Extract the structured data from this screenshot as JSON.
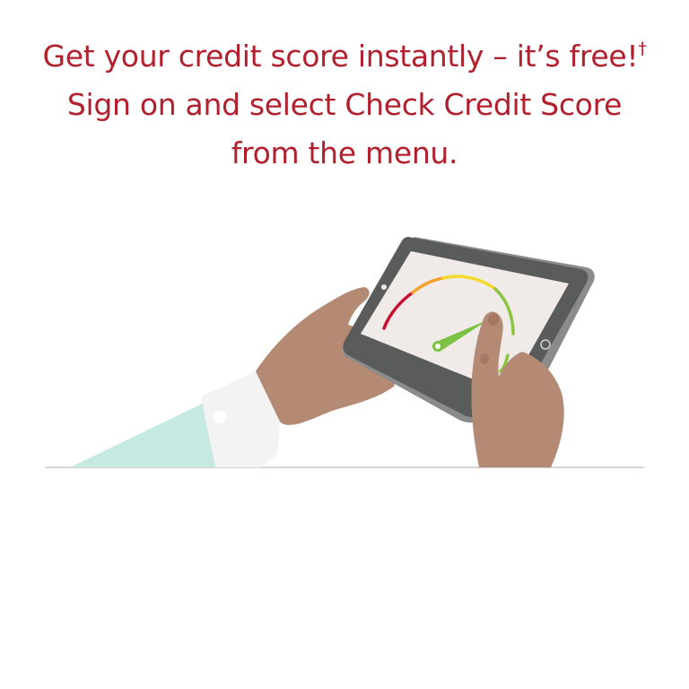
{
  "headline": {
    "part1": "Get your credit score instantly – it’s free!",
    "dagger": "†",
    "part2": " Sign on and select Check Credit Score from the menu."
  },
  "colors": {
    "headline": "#b21f2d",
    "skin": "#b48a74",
    "skin_shadow": "#a47862",
    "sleeve": "#c6e9e2",
    "cuff": "#f3f3f3",
    "tablet_frame": "#5a5c5c",
    "tablet_edge": "#8a8c8c",
    "screen": "#f0ebe9",
    "gauge_red": "#c8102e",
    "gauge_orange": "#f2a12c",
    "gauge_yellow": "#f4d92e",
    "gauge_green": "#8ac440",
    "needle": "#7cc242",
    "ground_line": "#c9c9c9"
  },
  "icons": {
    "tablet": "tablet-icon",
    "gauge": "credit-score-gauge-icon",
    "hands": "hands-holding-tablet"
  }
}
